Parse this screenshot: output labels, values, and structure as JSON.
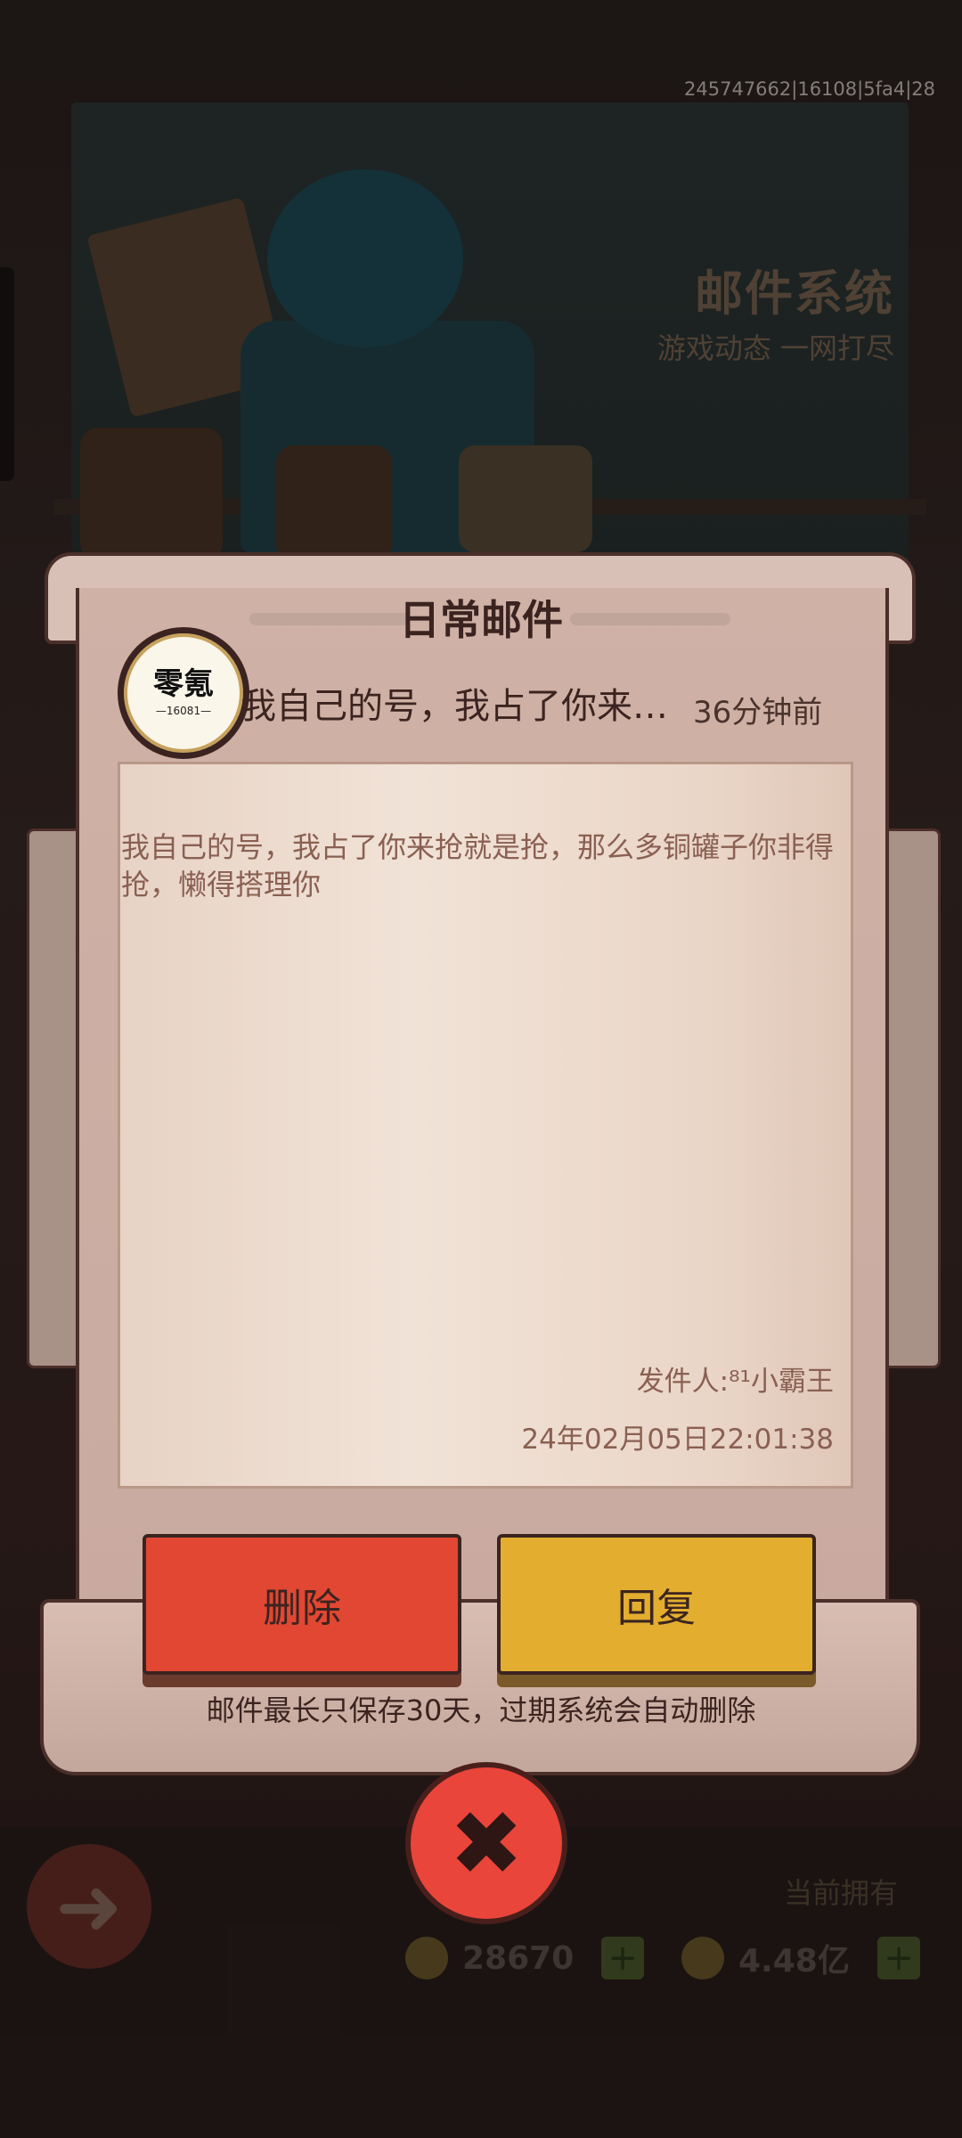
{
  "version_info": "245747662|16108|5fa4|28",
  "banner": {
    "title": "邮件系统",
    "subtitle": "游戏动态 一网打尽"
  },
  "modal": {
    "title": "日常邮件",
    "sender_avatar_text": "零氪",
    "sender_avatar_number": "—16081—",
    "mail_subject": "我自己的号，我占了你来…",
    "mail_time": "36分钟前",
    "body": "我自己的号，我占了你来抢就是抢，那么多铜罐子你非得抢，懒得搭理你",
    "sender_label": "发件人:⁸¹小霸王",
    "sent_at": "24年02月05日22:01:38",
    "delete_label": "删除",
    "reply_label": "回复",
    "notice": "邮件最长只保存30天，过期系统会自动删除",
    "close_icon": "close-icon"
  },
  "footer": {
    "owned_label": "当前拥有",
    "resource_1_value": "28670",
    "resource_2_value": "4.48亿",
    "back_icon": "back-arrow-icon"
  },
  "colors": {
    "delete_button": "#e14732",
    "reply_button": "#e3ae2f",
    "close_button": "#e9453a",
    "paper": "#cfb1a6"
  }
}
